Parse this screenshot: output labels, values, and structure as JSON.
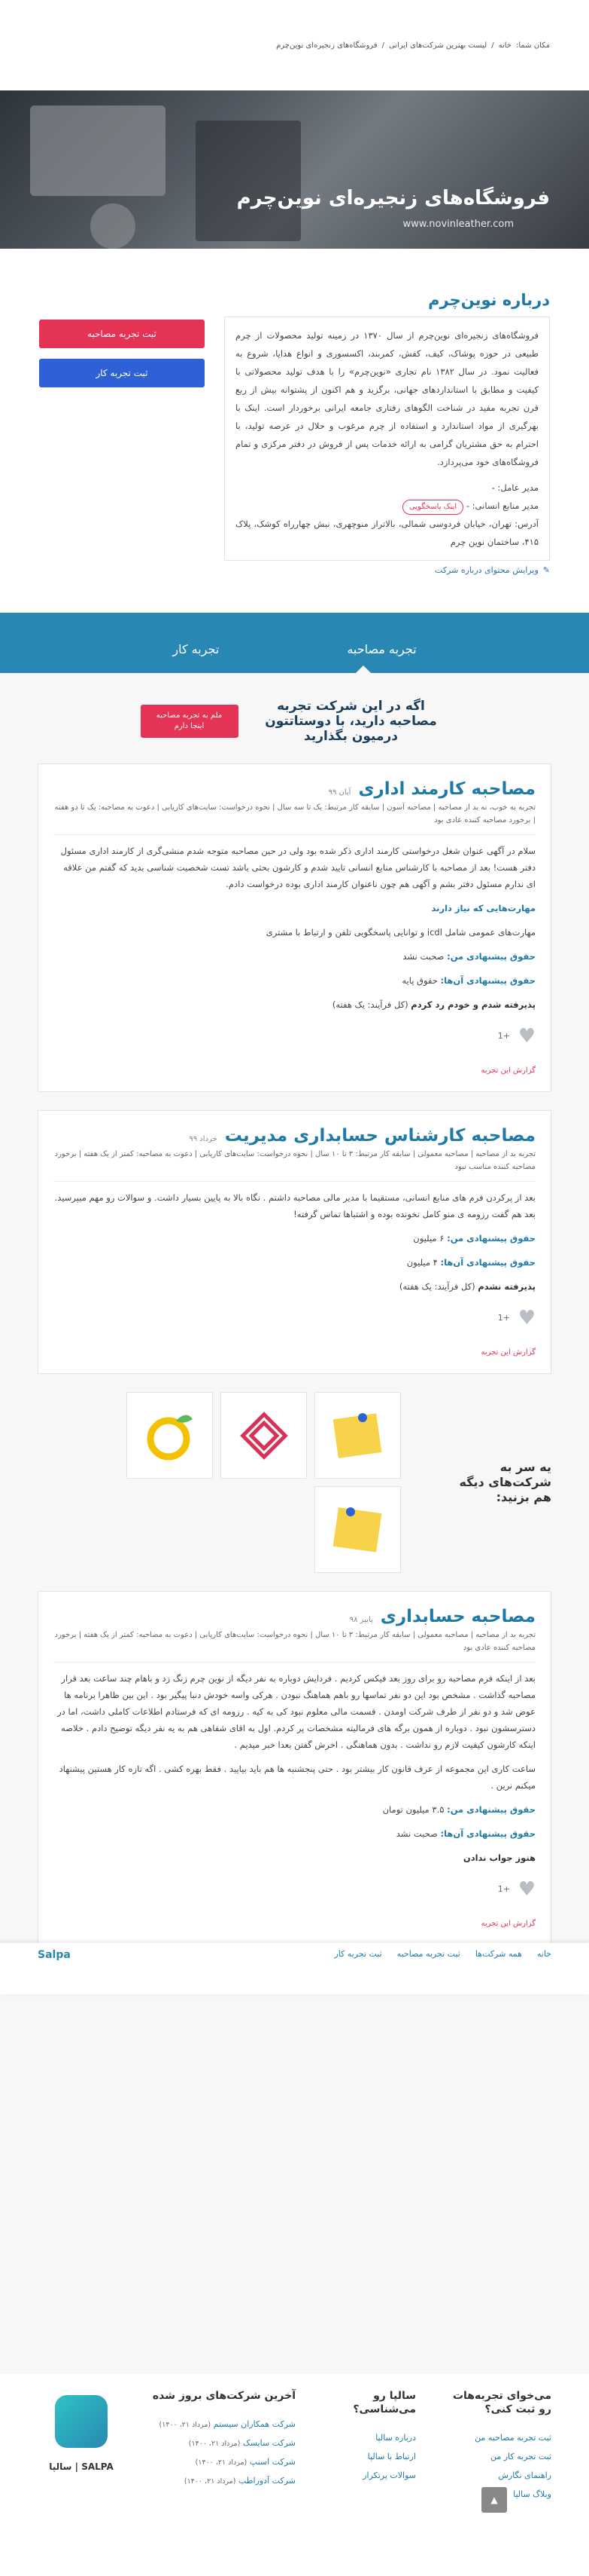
{
  "breadcrumb": {
    "prefix": "مکان شما:",
    "items": [
      "خانه",
      "لیست بهترین شرکت‌های ایرانی",
      "فروشگاه‌های زنجیره‌ای نوین‌چرم"
    ]
  },
  "hero": {
    "title": "فروشگاه‌های زنجیره‌ای نوین‌چرم",
    "url": "www.novinleather.com"
  },
  "about": {
    "title": "درباره نوین‌چرم",
    "text": "فروشگاه‌های زنجیره‌ای نوین‌چرم از سال ۱۳۷۰ در زمینه تولید محصولات از چرم طبیعی در حوزه پوشاک، کیف، کفش، کمربند، اکسسوری و انواع هدایا، شروع به فعالیت نمود. در سال ۱۳۸۲ نام تجاری «نوین‌چرم» را با هدف تولید محصولاتی با کیفیت و مطابق با استانداردهای جهانی، برگزید و هم اکنون از پشتوانه بیش از ربع قرن تجربه مفید در شناخت الگوهای رفتاری جامعه ایرانی برخوردار است. اینک با بهرگیری از مواد استاندارد و استفاده از چرم مرغوب و حلال در عرصه تولید، با احترام به حق مشتریان گرامی به ارائه خدمات پس از فروش در دفتر مرکزی و تمام فروشگاه‌های خود می‌پردازد.",
    "ceo": "مدیر عامل: -",
    "hr_label": "مدیر منابع انسانی: -",
    "hr_tag": "اینک پاسخگویی",
    "address": "آدرس: تهران، خیابان فردوسی شمالی، بالاتراز منوچهری، نبش چهارراه کوشک، پلاک ۴۱۵، ساختمان نوین چرم",
    "edit": "ویرایش محتوای درباره شرکت",
    "btn_interview": "ثبت تجربه مصاحبه",
    "btn_work": "ثبت تجربه کار"
  },
  "tabs": {
    "interview": "تجربه مصاحبه",
    "work": "تجربه کار"
  },
  "cta": {
    "text": "اگه در این شرکت تجربه مصاحبه دارید، با دوستاتتون درمیون بگذارید",
    "button": "ملم به تجربه مصاحبه اینجا دارم"
  },
  "cards": [
    {
      "title": "مصاحبه کارمند اداری",
      "date": "آبان ۹۹",
      "meta": "تجربه به خوب، نه بد از مصاحبه | مصاحبه آسون | سابقه کار مرتبط: یک تا سه سال | نحوه درخواست: سایت‌های کاریابی | دعوت به مصاحبه: یک تا دو هفته | برخورد مصاحبه کننده عادی بود",
      "body": "سلام در آگهی عنوان شغل درخواستی کارمند اداری ذکر شده بود ولی در حین مصاحبه متوجه شدم منشی‌گری از کارمند اداری مسئول دفتر هست! بعد از مصاحبه با کارشناس منابع انسانی تایید شدم و کارشون بحثی باشد تست شخصیت شناسی بدید که گفتم من علاقه ای ندارم مسئول دفتر بشم و آگهی هم چون ناعنوان کارمند اداری بوده درخواست دادم.",
      "skills_label": "مهارت‌هایی که نیاز دارند",
      "skills": "مهارت‌های عمومی شامل icdl و توانایی پاسخگویی تلفن و ارتباط با مشتری",
      "salary_mine_label": "حقوق پیشنهادی من:",
      "salary_mine": "صحبت نشد",
      "salary_theirs_label": "حقوق پیشنهادی آن‌ها:",
      "salary_theirs": "حقوق پایه",
      "result_label": "پذیرفته شدم و خودم رد کردم",
      "result_note": "(کل فرآیند: یک هفته)",
      "likes": "+1",
      "report": "گزارش این تجربه"
    },
    {
      "title": "مصاحبه کارشناس حسابداری مدیریت",
      "date": "خرداد ۹۹",
      "meta": "تجربه بد از مصاحبه | مصاحبه معمولی | سابقه کار مرتبط: ۳ تا ۱۰ سال | نحوه درخواست: سایت‌های کاریابی | دعوت به مصاحبه: کمتر از یک هفته | برخورد مصاحبه کننده مناسب نبود",
      "body": "بعد از پرکردن فرم های منابع انسانی، مستقیما با مدیر مالی مصاحبه داشتم . نگاه بالا به پایین بسیار داشت. و سوالات رو مهم میپرسید. بعد هم گفت رزومه ی منو کامل نخونده بوده و اشتباها تماس گرفته!",
      "salary_mine_label": "حقوق پیشنهادی من:",
      "salary_mine": "۶ میلیون",
      "salary_theirs_label": "حقوق پیشنهادی آن‌ها:",
      "salary_theirs": "۴ میلیون",
      "result_label": "پذیرفته نشدم",
      "result_note": "(کل فرآیند: یک هفته)",
      "likes": "+1",
      "report": "گزارش این تجربه"
    },
    {
      "title": "مصاحبه حسابداری",
      "date": "پاییز ۹۸",
      "meta": "تجربه بد از مصاحبه | مصاحبه معمولی | سابقه کار مرتبط: ۳ تا ۱۰ سال | نحوه درخواست: سایت‌های کاریابی | دعوت به مصاحبه: کمتر از یک هفته | برخورد مصاحبه کننده عادی بود",
      "body": "بعد از اینکه فرم مصاحبه رو برای روز بعد فیکس کردیم . فردایش دوباره به نفر دیگه از نوین چرم زنگ زد و باهام چند ساعت بعد قرار مصاحبه گذاشت . مشخص بود این دو نفر تماسها رو باهم هماهنگ نبودن . هرکی واسه خودش دنبا پیگیر بود . این بین ظاهرا برنامه ها عوض شد و دو نفر از طرف شرکت اومدن . قسمت مالی معلوم نبود کی به کیه . رزومه ای که فرستادم اطلاعات کاملی داشت، اما در دسترسشون نبود . دوباره از همون برگه های فرمالیته مشخصات پر کردم. اول به اقای شفاهی هم به یه نفر دیگه توضیح دادم . خلاصه اینکه کارشون کیفیت لازم رو نداشت . بدون هماهنگی . اخرش گفتن بعدا خبر میدیم .",
      "summary": "ساعت کاری این مجموعه از عرف قانون کار بیشتر بود . حتی پنجشنبه ها هم باید بیایید . فقط بهره کشی . اگه تازه کار هستین پیشنهاد میکنم نرین .",
      "salary_mine_label": "حقوق پیشنهادی من:",
      "salary_mine": "۳.۵ میلیون تومان",
      "salary_theirs_label": "حقوق پیشنهادی آن‌ها:",
      "salary_theirs": "صحبت نشد",
      "result_label": "هنوز جواب ندادن",
      "result_note": "",
      "likes": "+1",
      "report": "گزارش این تجربه"
    }
  ],
  "others": {
    "title": "یه سر به شرکت‌های دیگه هم بزنید:"
  },
  "sticky": {
    "brand": "Salpa",
    "links": [
      "خانه",
      "همه شرکت‌ها",
      "ثبت تجربه مصاحبه",
      "ثبت تجربه کار"
    ]
  },
  "footer": {
    "col1": {
      "title": "می‌خوای تجربه‌هات رو ثبت کنی؟",
      "links": [
        "ثبت تجربه مصاحبه من",
        "ثبت تجربه کار من",
        "راهنمای نگارش",
        "وبلاگ سالپا"
      ]
    },
    "col2": {
      "title": "سالپا رو می‌شناسی؟",
      "links": [
        "درباره سالپا",
        "ارتباط با سالپا",
        "سوالات پرتکرار"
      ]
    },
    "col3": {
      "title": "آخرین شرکت‌های بروز شده",
      "items": [
        {
          "name": "شرکت همکاران سیستم",
          "date": "(مرداد ۲۱، ۱۴۰۰)"
        },
        {
          "name": "شرکت سایسک",
          "date": "(مرداد ۲۱، ۱۴۰۰)"
        },
        {
          "name": "شرکت اسنپ",
          "date": "(مرداد ۲۱، ۱۴۰۰)"
        },
        {
          "name": "شرکت آدوراطب",
          "date": "(مرداد ۲۱، ۱۴۰۰)"
        }
      ]
    },
    "brand": "SALPA | سالپا"
  },
  "colors": {
    "primary": "#1f7aa8",
    "accent": "#e53356",
    "blue": "#2f61d6",
    "band": "#2988b3"
  }
}
